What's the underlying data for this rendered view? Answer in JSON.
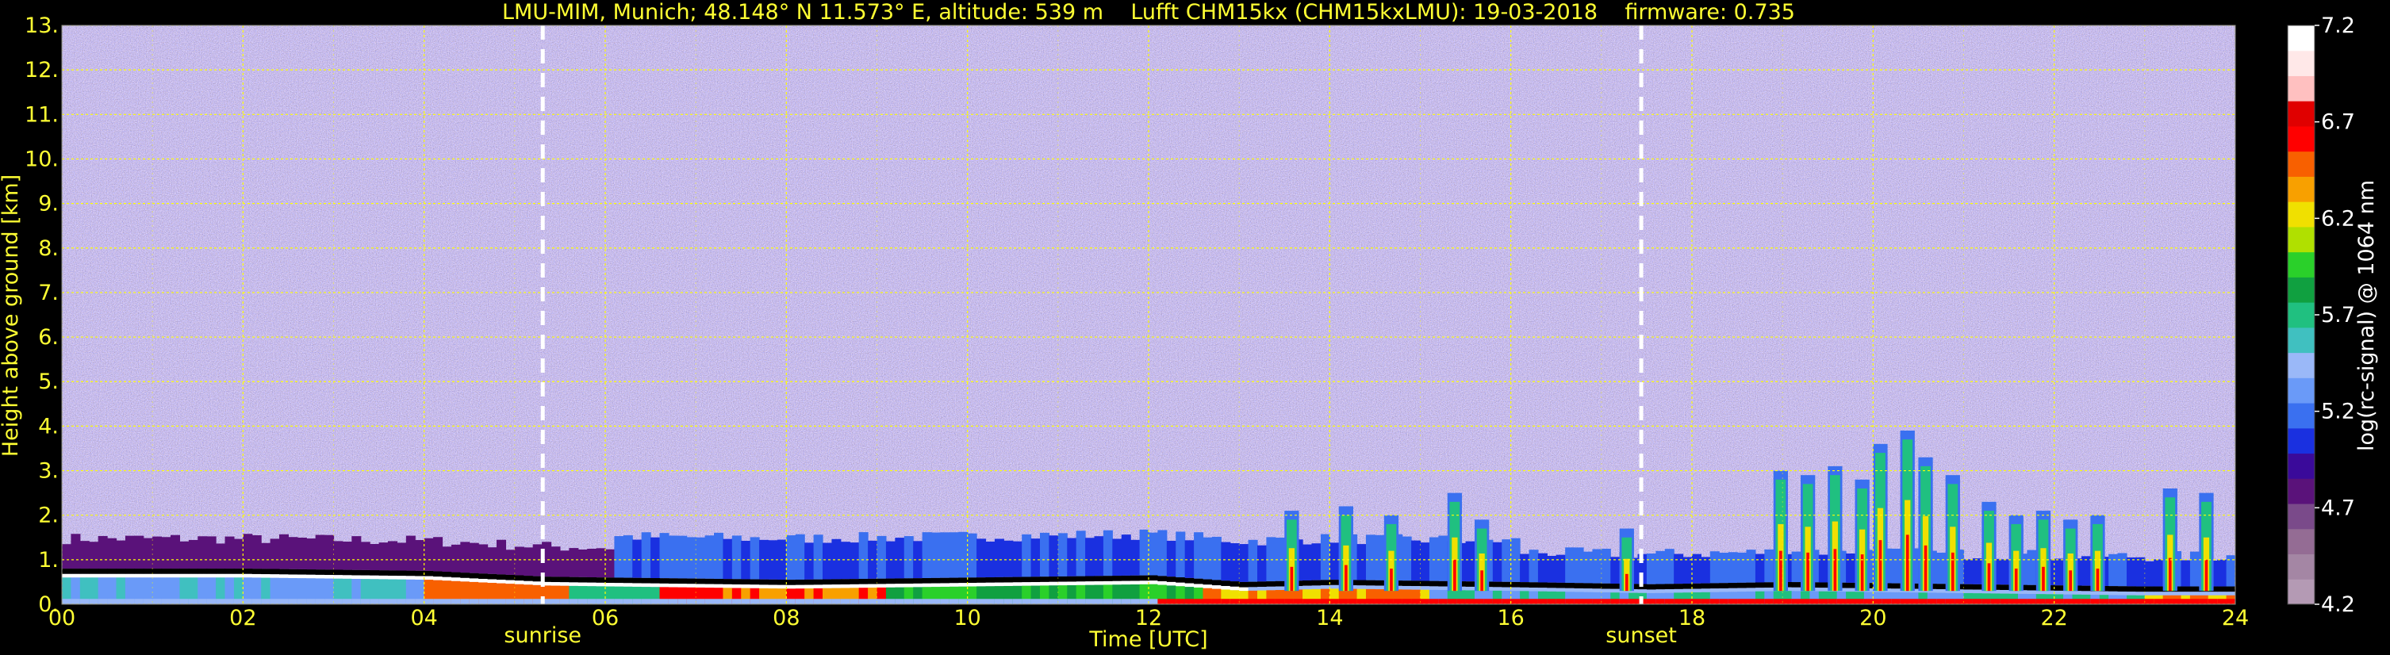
{
  "chart_data": {
    "type": "heatmap",
    "title": "LMU-MIM, Munich; 48.148° N 11.573° E, altitude: 539 m    Lufft CHM15kx (CHM15kxLMU): 19-03-2018    firmware: 0.735",
    "xlabel": "Time [UTC]",
    "ylabel": "Height above ground [km]",
    "xlim": [
      0,
      24
    ],
    "ylim": [
      0,
      13
    ],
    "x_ticks": [
      "00",
      "02",
      "04",
      "06",
      "08",
      "10",
      "12",
      "14",
      "16",
      "18",
      "20",
      "22",
      "24"
    ],
    "y_ticks": [
      "0.",
      "1.",
      "2.",
      "3.",
      "4.",
      "5.",
      "6.",
      "7.",
      "8.",
      "9.",
      "10.",
      "11.",
      "12.",
      "13."
    ],
    "grid": true,
    "colorbar": {
      "label": "log(rc-signal) @ 1064 nm",
      "range": [
        4.2,
        7.2
      ],
      "ticks": [
        "4.2",
        "4.7",
        "5.2",
        "5.7",
        "6.2",
        "6.7",
        "7.2"
      ],
      "tick_values": [
        4.2,
        4.7,
        5.2,
        5.7,
        6.2,
        6.7,
        7.2
      ],
      "colors": [
        "#b49ab4",
        "#a486a4",
        "#946c94",
        "#7a4a8a",
        "#5a127a",
        "#3a0a9a",
        "#1a30e0",
        "#3a70f0",
        "#6a9af8",
        "#9ab8f8",
        "#40c0c0",
        "#20c080",
        "#10a040",
        "#2ad02a",
        "#b0e000",
        "#f0e000",
        "#f8a000",
        "#f86000",
        "#ff0000",
        "#e00000",
        "#ffc0c0",
        "#ffe8e8",
        "#ffffff"
      ]
    },
    "annotations": [
      {
        "text": "sunrise",
        "x": 5.31
      },
      {
        "text": "sunset",
        "x": 17.44
      }
    ],
    "features": {
      "aerosol_layer_top_km": [
        {
          "t": 0,
          "h": 0.8
        },
        {
          "t": 2,
          "h": 0.8
        },
        {
          "t": 4,
          "h": 0.75
        },
        {
          "t": 5.3,
          "h": 0.62
        },
        {
          "t": 6,
          "h": 0.6
        },
        {
          "t": 8,
          "h": 0.55
        },
        {
          "t": 10,
          "h": 0.6
        },
        {
          "t": 12,
          "h": 0.65
        },
        {
          "t": 13,
          "h": 0.5
        },
        {
          "t": 14,
          "h": 0.55
        },
        {
          "t": 16,
          "h": 0.5
        },
        {
          "t": 17.5,
          "h": 0.45
        },
        {
          "t": 19,
          "h": 0.5
        },
        {
          "t": 21,
          "h": 0.45
        },
        {
          "t": 22.9,
          "h": 0.4
        }
      ]
    }
  },
  "colors": {
    "text": "#ffff33",
    "grid": "#ffff00",
    "background": "#000000",
    "colorbar_text": "#ffffff"
  }
}
